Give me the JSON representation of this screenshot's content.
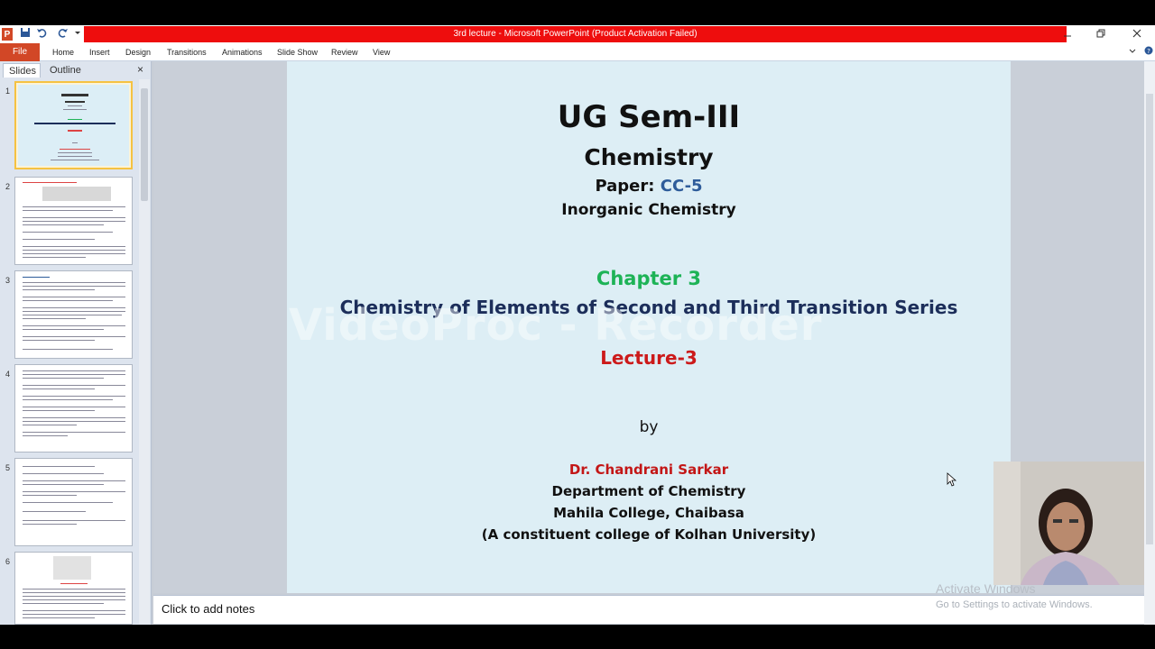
{
  "window": {
    "title": "3rd lecture  -  Microsoft PowerPoint (Product Activation Failed)"
  },
  "quick_access": {
    "app_icon": "P"
  },
  "ribbon": {
    "file_tab": "File",
    "tabs": [
      "Home",
      "Insert",
      "Design",
      "Transitions",
      "Animations",
      "Slide Show",
      "Review",
      "View"
    ]
  },
  "panel": {
    "tabs": [
      "Slides",
      "Outline"
    ],
    "close_glyph": "×",
    "thumb_numbers": [
      "1",
      "2",
      "3",
      "4",
      "5",
      "6"
    ]
  },
  "slide": {
    "title": "UG Sem-III",
    "subject": "Chemistry",
    "paper_label": "Paper: ",
    "paper_code": "CC-5",
    "course": "Inorganic Chemistry",
    "chapter": "Chapter 3",
    "chapter_title": "Chemistry of Elements of Second and Third Transition Series",
    "lecture": "Lecture-3",
    "by": "by",
    "author": "Dr. Chandrani Sarkar",
    "department": "Department of Chemistry",
    "college": "Mahila College, Chaibasa",
    "university": "(A constituent college of Kolhan University)"
  },
  "watermark": "VideoProc - Recorder",
  "notes": {
    "placeholder": "Click to add notes"
  },
  "activation": {
    "line1": "Activate Windows",
    "line2": "Go to Settings to activate Windows."
  }
}
